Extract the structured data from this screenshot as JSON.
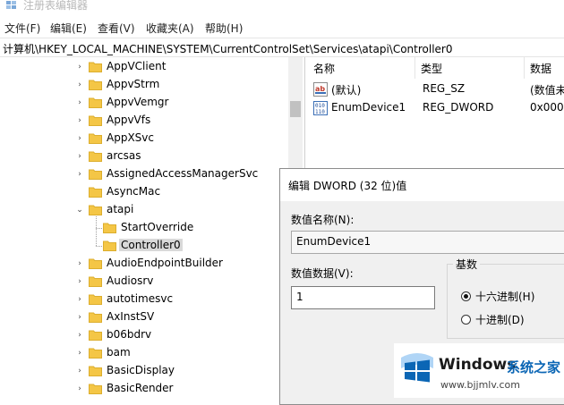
{
  "window": {
    "title": "注册表编辑器"
  },
  "menu": [
    "文件(F)",
    "编辑(E)",
    "查看(V)",
    "收藏夹(A)",
    "帮助(H)"
  ],
  "address": "计算机\\HKEY_LOCAL_MACHINE\\SYSTEM\\CurrentControlSet\\Services\\atapi\\Controller0",
  "tree": {
    "items": [
      {
        "label": "AppVClient",
        "level": 1,
        "expander": "›"
      },
      {
        "label": "AppvStrm",
        "level": 1,
        "expander": "›"
      },
      {
        "label": "AppvVemgr",
        "level": 1,
        "expander": "›"
      },
      {
        "label": "AppvVfs",
        "level": 1,
        "expander": "›"
      },
      {
        "label": "AppXSvc",
        "level": 1,
        "expander": "›"
      },
      {
        "label": "arcsas",
        "level": 1,
        "expander": "›"
      },
      {
        "label": "AssignedAccessManagerSvc",
        "level": 1,
        "expander": "›"
      },
      {
        "label": "AsyncMac",
        "level": 1,
        "expander": ""
      },
      {
        "label": "atapi",
        "level": 1,
        "expander": "⌄"
      },
      {
        "label": "StartOverride",
        "level": 2,
        "expander": ""
      },
      {
        "label": "Controller0",
        "level": 2,
        "expander": "",
        "selected": true
      },
      {
        "label": "AudioEndpointBuilder",
        "level": 1,
        "expander": "›"
      },
      {
        "label": "Audiosrv",
        "level": 1,
        "expander": "›"
      },
      {
        "label": "autotimesvc",
        "level": 1,
        "expander": "›"
      },
      {
        "label": "AxInstSV",
        "level": 1,
        "expander": "›"
      },
      {
        "label": "b06bdrv",
        "level": 1,
        "expander": "›"
      },
      {
        "label": "bam",
        "level": 1,
        "expander": "›"
      },
      {
        "label": "BasicDisplay",
        "level": 1,
        "expander": "›"
      },
      {
        "label": "BasicRender",
        "level": 1,
        "expander": "›"
      }
    ]
  },
  "list": {
    "headers": [
      "名称",
      "类型",
      "数据"
    ],
    "rows": [
      {
        "name": "(默认)",
        "type": "REG_SZ",
        "data": "(数值未",
        "icon": "string-value-icon"
      },
      {
        "name": "EnumDevice1",
        "type": "REG_DWORD",
        "data": "0x000",
        "icon": "binary-value-icon"
      }
    ]
  },
  "dialog": {
    "title": "编辑 DWORD (32 位)值",
    "name_label": "数值名称(N):",
    "name_value": "EnumDevice1",
    "data_label": "数值数据(V):",
    "data_value": "1",
    "base_label": "基数",
    "hex_label": "十六进制(H)",
    "dec_label": "十进制(D)",
    "selected_base": "hex"
  },
  "watermark": {
    "brand": "Windows",
    "suffix": "系统之家",
    "url": "www.bjjmlv.com"
  },
  "colors": {
    "folder": "#f4c646",
    "folder_dark": "#dcae2e",
    "selection": "#d9d9d9",
    "windows_blue": "#0b66b5"
  }
}
